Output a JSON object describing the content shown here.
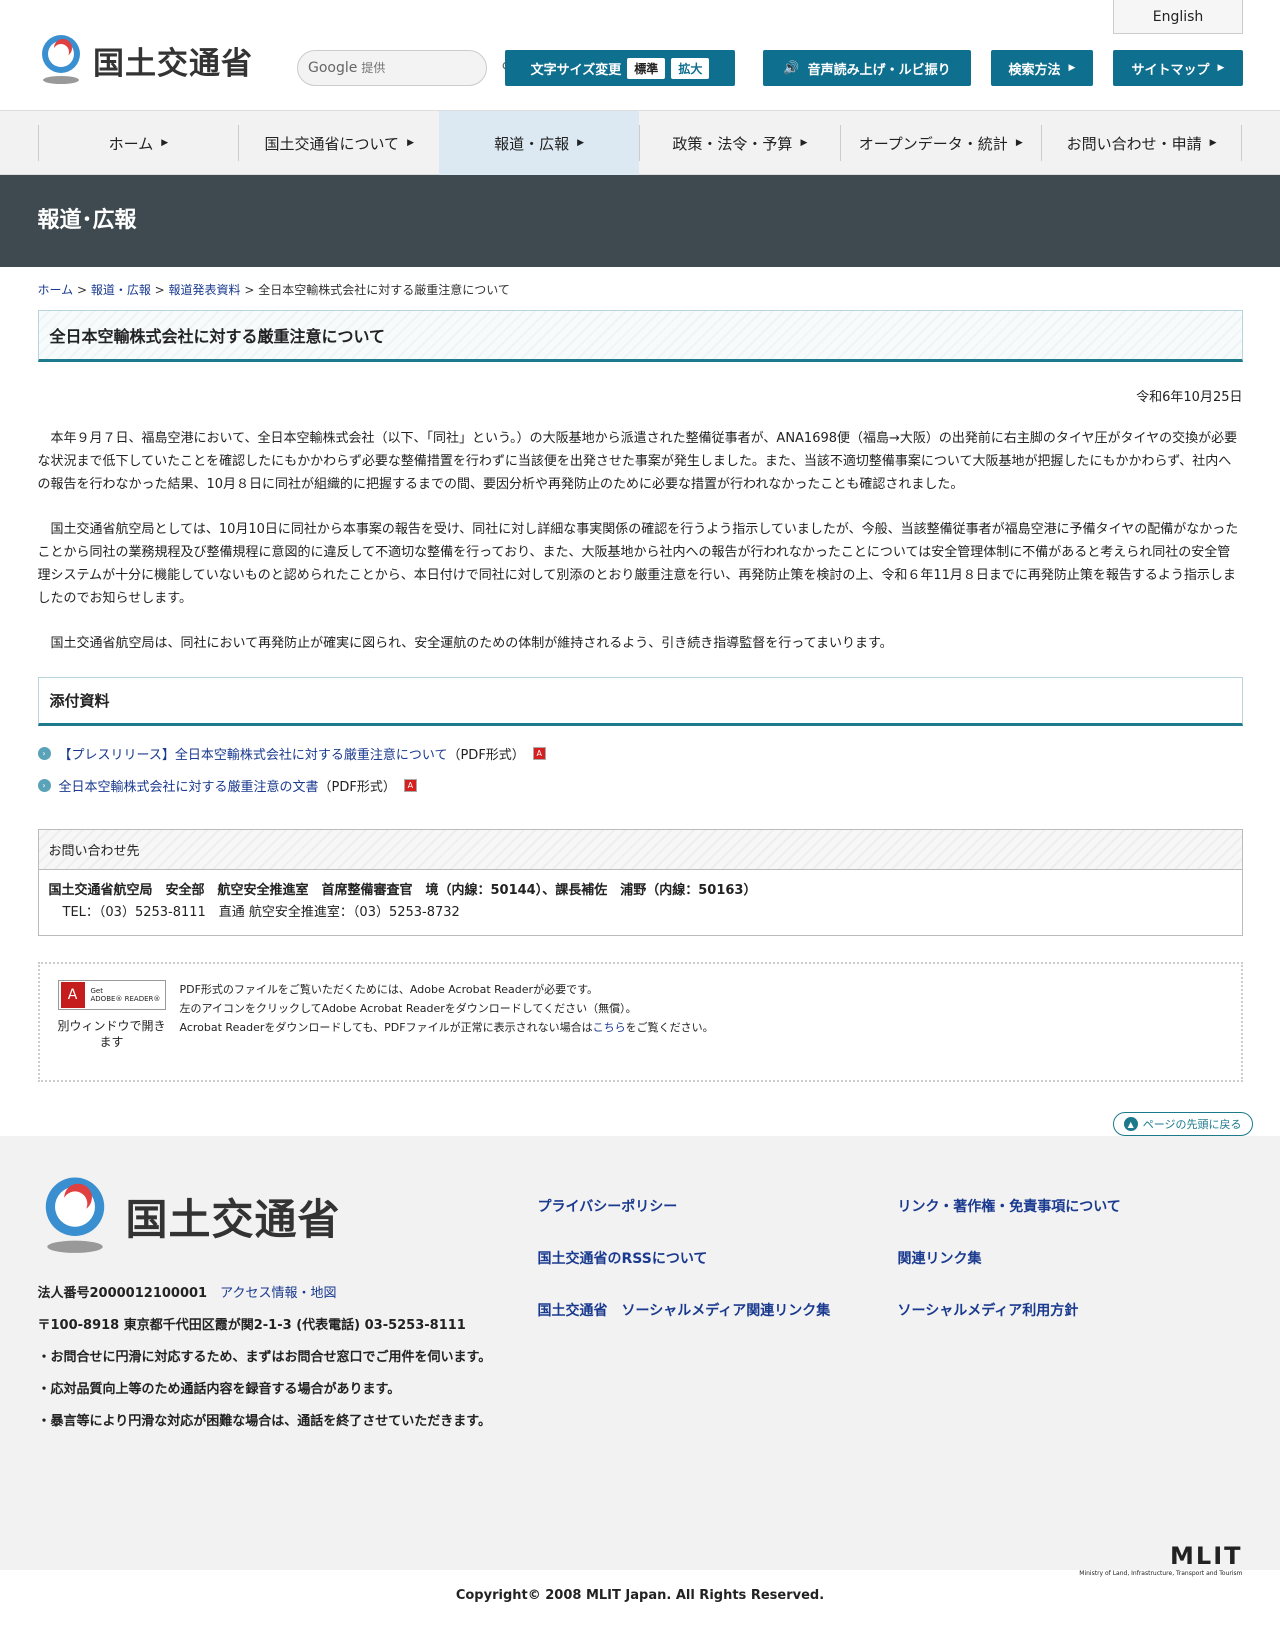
{
  "header": {
    "site_name": "国土交通省",
    "search_brand": "Google",
    "search_placeholder": "提供",
    "font_size_label": "文字サイズ変更",
    "font_size_standard": "標準",
    "font_size_large": "拡大",
    "speech_label": "音声読み上げ・ルビ振り",
    "search_method_label": "検索方法",
    "sitemap_label": "サイトマップ",
    "english_label": "English"
  },
  "nav": {
    "items": [
      {
        "label": "ホーム"
      },
      {
        "label": "国土交通省について"
      },
      {
        "label": "報道・広報"
      },
      {
        "label": "政策・法令・予算"
      },
      {
        "label": "オープンデータ・統計"
      },
      {
        "label": "お問い合わせ・申請"
      }
    ]
  },
  "band_title": "報道･広報",
  "breadcrumb": {
    "home": "ホーム",
    "press": "報道・広報",
    "releases": "報道発表資料",
    "current": "全日本空輸株式会社に対する厳重注意について",
    "sep": " > "
  },
  "article": {
    "title": "全日本空輸株式会社に対する厳重注意について",
    "date": "令和6年10月25日",
    "paragraphs": [
      "本年９月７日、福島空港において、全日本空輸株式会社（以下、「同社」という。）の大阪基地から派遣された整備従事者が、ANA1698便（福島→大阪）の出発前に右主脚のタイヤ圧がタイヤの交換が必要な状況まで低下していたことを確認したにもかかわらず必要な整備措置を行わずに当該便を出発させた事案が発生しました。また、当該不適切整備事案について大阪基地が把握したにもかかわらず、社内への報告を行わなかった結果、10月８日に同社が組織的に把握するまでの間、要因分析や再発防止のために必要な措置が行われなかったことも確認されました。",
      "国土交通省航空局としては、10月10日に同社から本事案の報告を受け、同社に対し詳細な事実関係の確認を行うよう指示していましたが、今般、当該整備従事者が福島空港に予備タイヤの配備がなかったことから同社の業務規程及び整備規程に意図的に違反して不適切な整備を行っており、また、大阪基地から社内への報告が行われなかったことについては安全管理体制に不備があると考えられ同社の安全管理システムが十分に機能していないものと認められたことから、本日付けで同社に対して別添のとおり厳重注意を行い、再発防止策を検討の上、令和６年11月８日までに再発防止策を報告するよう指示しましたのでお知らせします。",
      "国土交通省航空局は、同社において再発防止が確実に図られ、安全運航のための体制が維持されるよう、引き続き指導監督を行ってまいります。"
    ]
  },
  "attachments": {
    "heading": "添付資料",
    "items": [
      {
        "label": "【プレスリリース】全日本空輸株式会社に対する厳重注意について",
        "format": "（PDF形式）"
      },
      {
        "label": "全日本空輸株式会社に対する厳重注意の文書",
        "format": "（PDF形式）"
      }
    ]
  },
  "contact": {
    "heading": "お問い合わせ先",
    "line1": "国土交通省航空局　安全部　航空安全推進室　首席整備審査官　境（内線：50144）、課長補佐　浦野（内線：50163）",
    "line2": "TEL：（03）5253-8111　直通 航空安全推進室：（03）5253-8732"
  },
  "reader": {
    "badge_get": "Get",
    "badge_name": "ADOBE® READER®",
    "window_note": "別ウィンドウで開きます",
    "line1": "PDF形式のファイルをご覧いただくためには、Adobe Acrobat Readerが必要です。",
    "line2": "左のアイコンをクリックしてAdobe Acrobat Readerをダウンロードしてください（無償）。",
    "line3_pre": "Acrobat Readerをダウンロードしても、PDFファイルが正常に表示されない場合は",
    "line3_link": "こちら",
    "line3_post": "をご覧ください。"
  },
  "pagetop_label": "ページの先頭に戻る",
  "footer": {
    "site_name": "国土交通省",
    "corp_number": "法人番号2000012100001",
    "access_link": "アクセス情報・地図",
    "address": "〒100-8918 東京都千代田区霞が関2-1-3 (代表電話) 03-5253-8111",
    "note1": "・お問合せに円滑に対応するため、まずはお問合せ窓口でご用件を伺います。",
    "note2": "・応対品質向上等のため通話内容を録音する場合があります。",
    "note3": "・暴言等により円滑な対応が困難な場合は、通話を終了させていただきます。",
    "links": [
      "プライバシーポリシー",
      "リンク・著作権・免責事項について",
      "国土交通省のRSSについて",
      "関連リンク集",
      "国土交通省　ソーシャルメディア関連リンク集",
      "ソーシャルメディア利用方針"
    ],
    "mlit_logo": "MLIT",
    "mlit_sub": "Ministry of Land, Infrastructure, Transport and Tourism",
    "copyright": "Copyright© 2008 MLIT Japan. All Rights Reserved."
  },
  "colors": {
    "brand": "#0f6f8f",
    "band": "#3e4a50",
    "accent_border": "#1d7a8c"
  }
}
